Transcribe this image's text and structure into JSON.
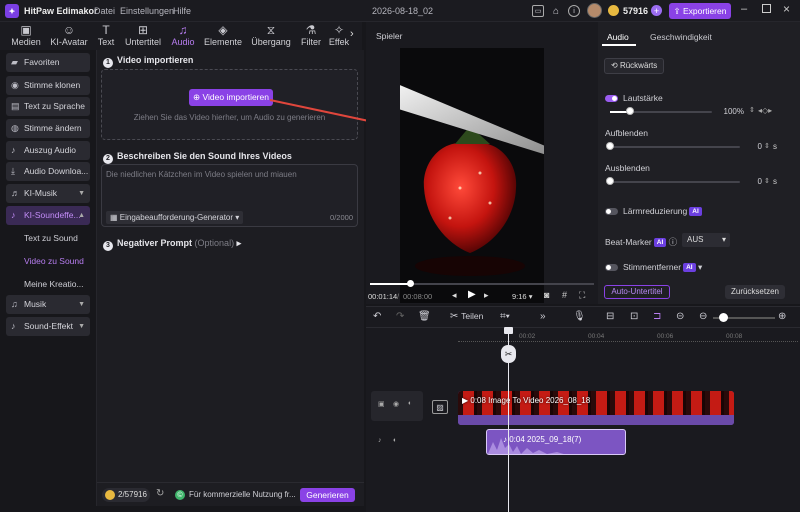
{
  "app": {
    "title": "HitPaw Edimakor",
    "menu": [
      "Datei",
      "Einstellungen",
      "Hilfe"
    ],
    "project_title": "2026-08-18_02",
    "credits": "57916",
    "export_label": "Exportieren"
  },
  "toolbar": {
    "tabs": [
      {
        "label": "Medien",
        "icon": "media-icon"
      },
      {
        "label": "KI-Avatar",
        "icon": "avatar-icon"
      },
      {
        "label": "Text",
        "icon": "text-icon"
      },
      {
        "label": "Untertitel",
        "icon": "subtitle-icon"
      },
      {
        "label": "Audio",
        "icon": "music-note-icon"
      },
      {
        "label": "Elemente",
        "icon": "elements-icon"
      },
      {
        "label": "Übergang",
        "icon": "transition-icon"
      },
      {
        "label": "Filter",
        "icon": "filter-icon"
      },
      {
        "label": "Effek",
        "icon": "effects-icon"
      }
    ],
    "active": "Audio"
  },
  "sidebar": {
    "items": [
      "Favoriten",
      "Stimme klonen",
      "Text zu Sprache",
      "Stimme ändern",
      "Auszug Audio",
      "Audio Downloa...",
      "KI-Musik",
      "KI-Soundeffe...",
      "Musik",
      "Sound-Effekt"
    ],
    "subitems": [
      "Text zu Sound",
      "Video zu Sound",
      "Meine Kreatio..."
    ]
  },
  "panel": {
    "step1": "Video importieren",
    "step1_num": "1",
    "import_button": "Video importieren",
    "drop_hint": "Ziehen Sie das Video hierher, um Audio zu generieren",
    "step2": "Beschreiben Sie den Sound Ihres Videos",
    "step2_num": "2",
    "prompt_placeholder": "Die niedlichen Kätzchen im Video spielen und miauen",
    "generator_label": "Eingabeaufforderung-Generator",
    "char_count": "0/2000",
    "step3": "Negativer Prompt",
    "step3_num": "3",
    "optional": "(Optional)",
    "footer_credits": "2/57916",
    "footer_info": "Für kommerzielle Nutzung fr...",
    "generate_button": "Generieren"
  },
  "player": {
    "label": "Spieler",
    "time_current": "00:01:14",
    "time_sep": "/",
    "time_total": "00:08:00",
    "aspect": "9:16",
    "progress": 0.18
  },
  "right": {
    "tabs": [
      "Audio",
      "Geschwindigkeit"
    ],
    "reverse": "Rückwärts",
    "volume_label": "Lautstärke",
    "volume_value": "100%",
    "volume_level": 0.2,
    "fade_in_label": "Aufblenden",
    "fade_in_value": "0",
    "fade_out_label": "Ausblenden",
    "fade_out_value": "0",
    "unit_s": "s",
    "noise_label": "Lärmreduzierung",
    "beat_label": "Beat-Marker",
    "beat_value": "AUS",
    "voice_label": "Stimmentferner",
    "ai": "AI",
    "auto_subtitle": "Auto-Untertitel",
    "reset": "Zurücksetzen"
  },
  "timeline": {
    "split_label": "Teilen",
    "ticks": [
      "00:02",
      "00:04",
      "00:06",
      "00:08"
    ],
    "video_clip": "0:08 Image To Video 2026_08_18",
    "audio_clip": "0:04 2025_09_18(7)"
  }
}
